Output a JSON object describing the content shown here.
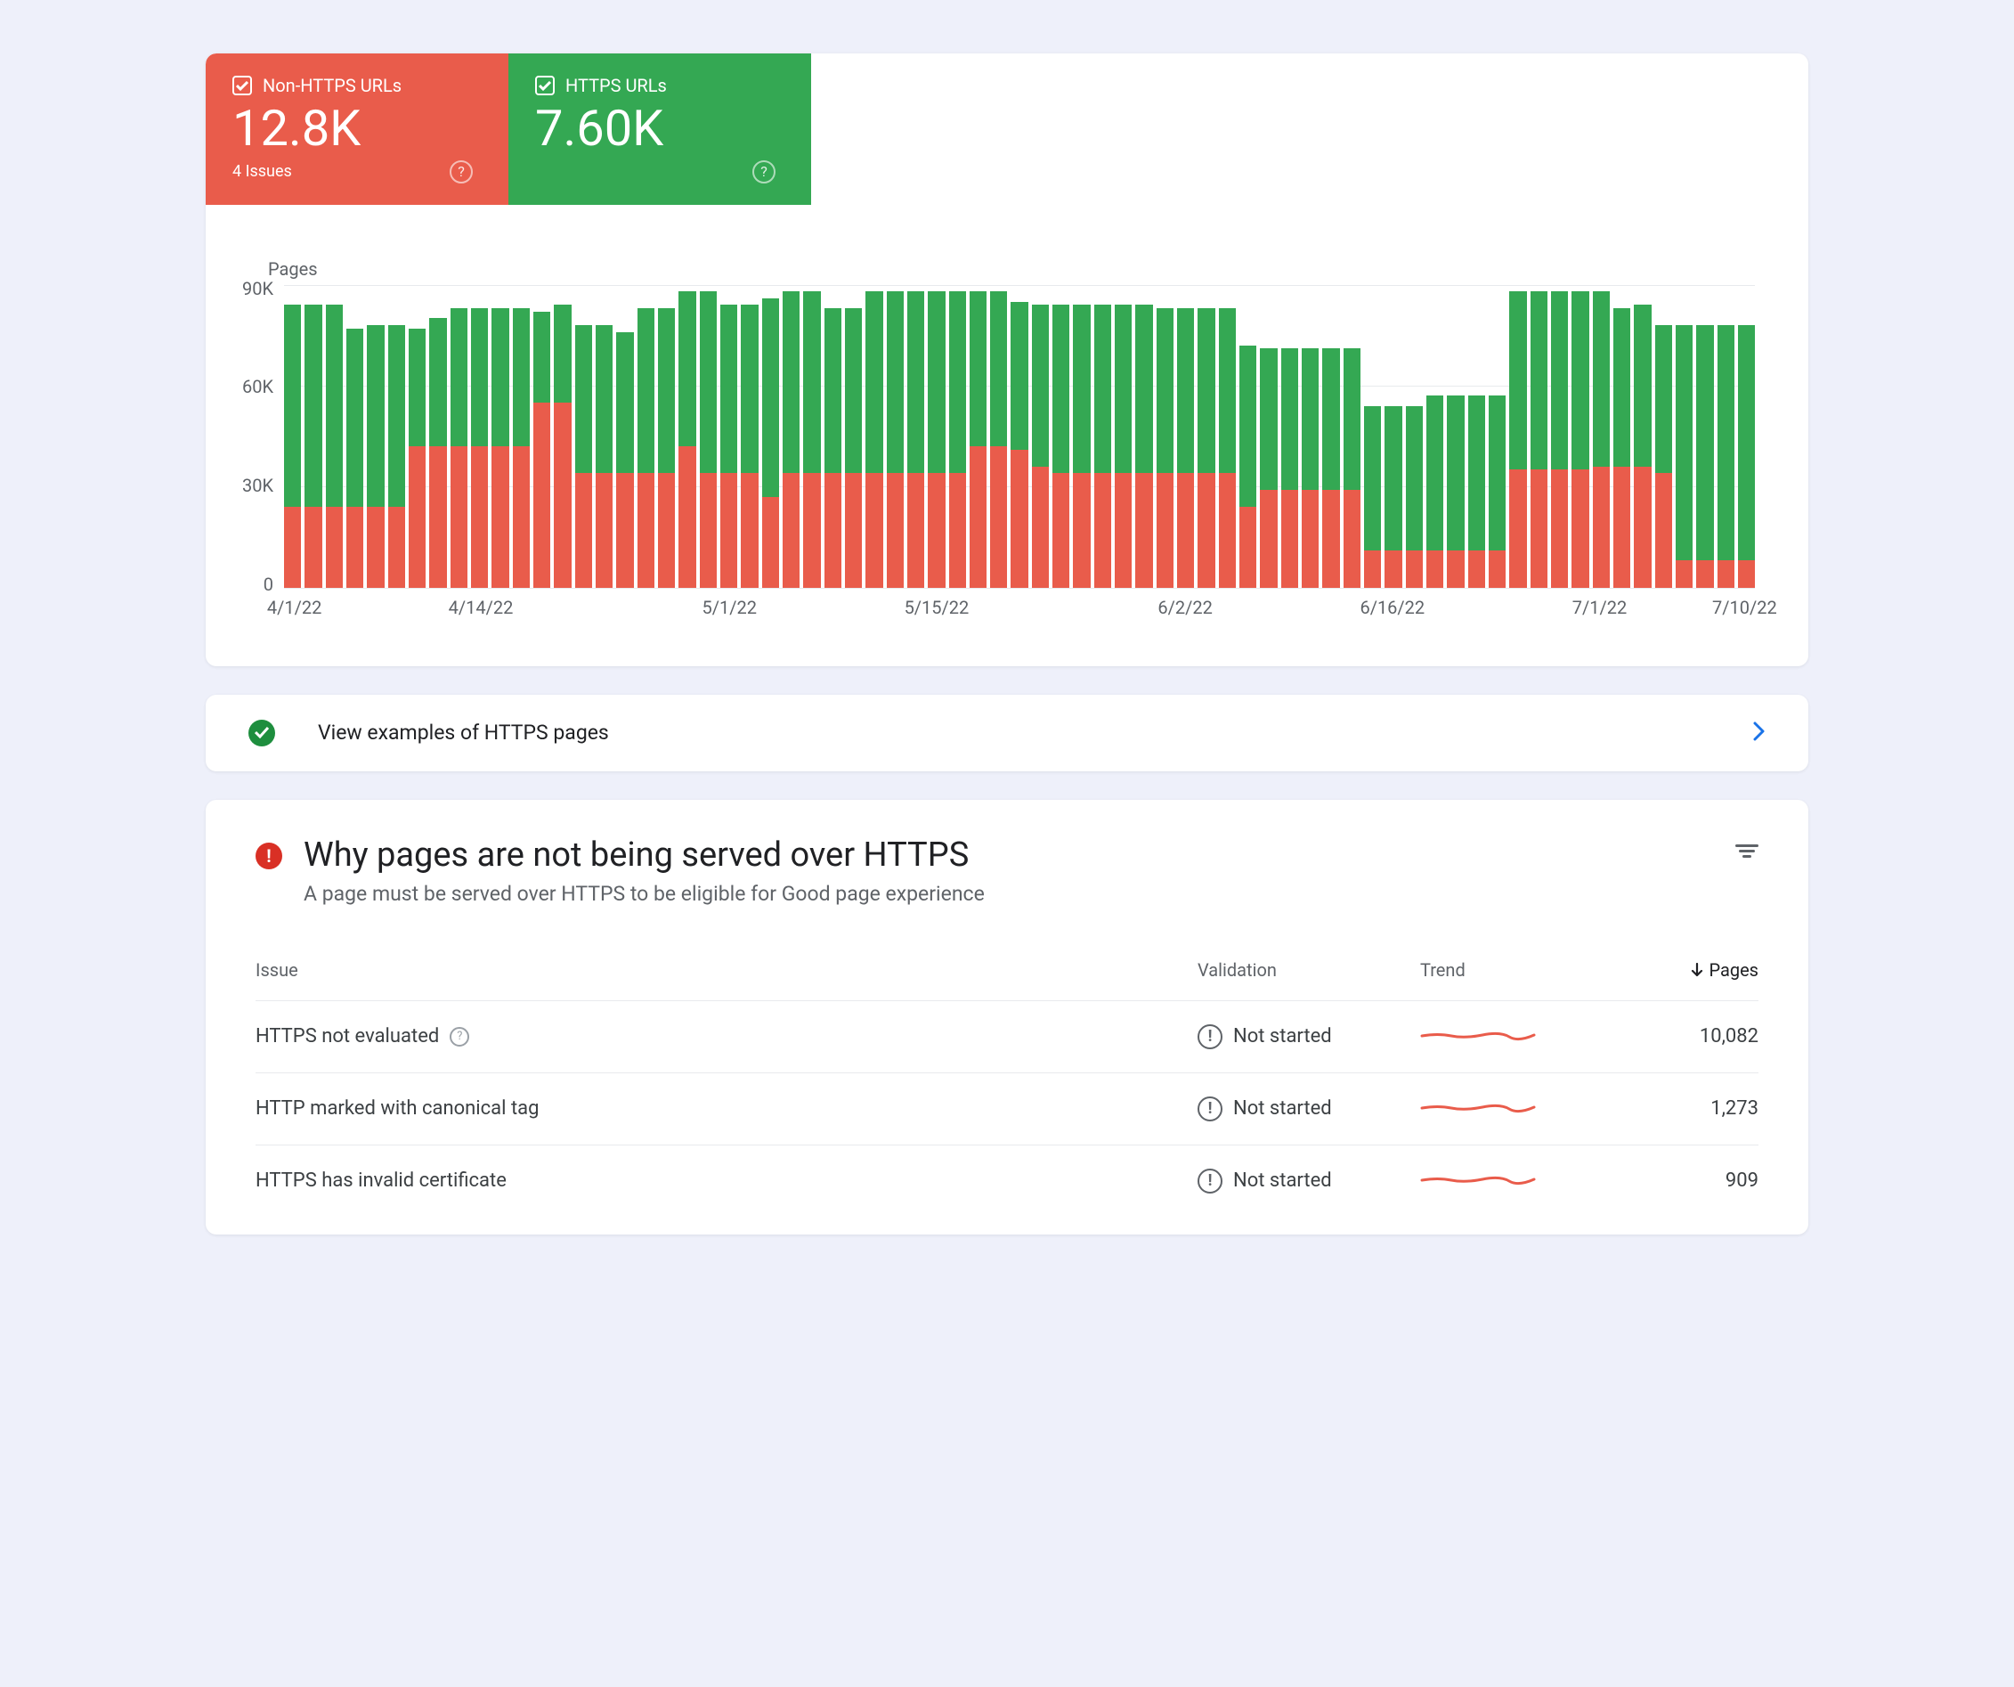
{
  "tabs": {
    "nonHttps": {
      "label": "Non-HTTPS URLs",
      "value": "12.8K",
      "issues": "4 Issues"
    },
    "https": {
      "label": "HTTPS URLs",
      "value": "7.60K"
    }
  },
  "colors": {
    "red": "#e95c4b",
    "green": "#34a853",
    "blue": "#1a73e8",
    "alert": "#d93025"
  },
  "chart_data": {
    "type": "bar",
    "ylabel": "Pages",
    "ylim": [
      0,
      90
    ],
    "y_unit": "K",
    "y_ticks": [
      0,
      30,
      60,
      90
    ],
    "x_ticks": [
      {
        "label": "4/1/22",
        "index": 0
      },
      {
        "label": "4/14/22",
        "index": 9
      },
      {
        "label": "5/1/22",
        "index": 21
      },
      {
        "label": "5/15/22",
        "index": 31
      },
      {
        "label": "6/2/22",
        "index": 43
      },
      {
        "label": "6/16/22",
        "index": 53
      },
      {
        "label": "7/1/22",
        "index": 63
      },
      {
        "label": "7/10/22",
        "index": 70
      }
    ],
    "series_stacked": [
      {
        "name": "Non-HTTPS URLs",
        "color": "#e95c4b"
      },
      {
        "name": "HTTPS URLs",
        "color": "#34a853"
      }
    ],
    "bars": [
      {
        "nonHttps": 24,
        "https": 60
      },
      {
        "nonHttps": 24,
        "https": 60
      },
      {
        "nonHttps": 24,
        "https": 60
      },
      {
        "nonHttps": 24,
        "https": 53
      },
      {
        "nonHttps": 24,
        "https": 54
      },
      {
        "nonHttps": 24,
        "https": 54
      },
      {
        "nonHttps": 42,
        "https": 35
      },
      {
        "nonHttps": 42,
        "https": 38
      },
      {
        "nonHttps": 42,
        "https": 41
      },
      {
        "nonHttps": 42,
        "https": 41
      },
      {
        "nonHttps": 42,
        "https": 41
      },
      {
        "nonHttps": 42,
        "https": 41
      },
      {
        "nonHttps": 55,
        "https": 27
      },
      {
        "nonHttps": 55,
        "https": 29
      },
      {
        "nonHttps": 34,
        "https": 44
      },
      {
        "nonHttps": 34,
        "https": 44
      },
      {
        "nonHttps": 34,
        "https": 42
      },
      {
        "nonHttps": 34,
        "https": 49
      },
      {
        "nonHttps": 34,
        "https": 49
      },
      {
        "nonHttps": 42,
        "https": 46
      },
      {
        "nonHttps": 34,
        "https": 54
      },
      {
        "nonHttps": 34,
        "https": 50
      },
      {
        "nonHttps": 34,
        "https": 50
      },
      {
        "nonHttps": 27,
        "https": 59
      },
      {
        "nonHttps": 34,
        "https": 54
      },
      {
        "nonHttps": 34,
        "https": 54
      },
      {
        "nonHttps": 34,
        "https": 49
      },
      {
        "nonHttps": 34,
        "https": 49
      },
      {
        "nonHttps": 34,
        "https": 54
      },
      {
        "nonHttps": 34,
        "https": 54
      },
      {
        "nonHttps": 34,
        "https": 54
      },
      {
        "nonHttps": 34,
        "https": 54
      },
      {
        "nonHttps": 34,
        "https": 54
      },
      {
        "nonHttps": 42,
        "https": 46
      },
      {
        "nonHttps": 42,
        "https": 46
      },
      {
        "nonHttps": 41,
        "https": 44
      },
      {
        "nonHttps": 36,
        "https": 48
      },
      {
        "nonHttps": 34,
        "https": 50
      },
      {
        "nonHttps": 34,
        "https": 50
      },
      {
        "nonHttps": 34,
        "https": 50
      },
      {
        "nonHttps": 34,
        "https": 50
      },
      {
        "nonHttps": 34,
        "https": 50
      },
      {
        "nonHttps": 34,
        "https": 49
      },
      {
        "nonHttps": 34,
        "https": 49
      },
      {
        "nonHttps": 34,
        "https": 49
      },
      {
        "nonHttps": 34,
        "https": 49
      },
      {
        "nonHttps": 24,
        "https": 48
      },
      {
        "nonHttps": 29,
        "https": 42
      },
      {
        "nonHttps": 29,
        "https": 42
      },
      {
        "nonHttps": 29,
        "https": 42
      },
      {
        "nonHttps": 29,
        "https": 42
      },
      {
        "nonHttps": 29,
        "https": 42
      },
      {
        "nonHttps": 11,
        "https": 43
      },
      {
        "nonHttps": 11,
        "https": 43
      },
      {
        "nonHttps": 11,
        "https": 43
      },
      {
        "nonHttps": 11,
        "https": 46
      },
      {
        "nonHttps": 11,
        "https": 46
      },
      {
        "nonHttps": 11,
        "https": 46
      },
      {
        "nonHttps": 11,
        "https": 46
      },
      {
        "nonHttps": 35,
        "https": 53
      },
      {
        "nonHttps": 35,
        "https": 53
      },
      {
        "nonHttps": 35,
        "https": 53
      },
      {
        "nonHttps": 35,
        "https": 53
      },
      {
        "nonHttps": 36,
        "https": 52
      },
      {
        "nonHttps": 36,
        "https": 47
      },
      {
        "nonHttps": 36,
        "https": 48
      },
      {
        "nonHttps": 34,
        "https": 44
      },
      {
        "nonHttps": 8,
        "https": 70
      },
      {
        "nonHttps": 8,
        "https": 70
      },
      {
        "nonHttps": 8,
        "https": 70
      },
      {
        "nonHttps": 8,
        "https": 70
      }
    ]
  },
  "link_row": {
    "label": "View examples of HTTPS pages"
  },
  "issues_section": {
    "title": "Why pages are not being served over HTTPS",
    "subtitle": "A page must be served over HTTPS to be eligible for Good page experience",
    "columns": {
      "issue": "Issue",
      "validation": "Validation",
      "trend": "Trend",
      "pages": "Pages"
    },
    "rows": [
      {
        "name": "HTTPS not evaluated",
        "help": true,
        "validation": "Not started",
        "pages": "10,082"
      },
      {
        "name": "HTTP marked with canonical tag",
        "help": false,
        "validation": "Not started",
        "pages": "1,273"
      },
      {
        "name": "HTTPS has invalid certificate",
        "help": false,
        "validation": "Not started",
        "pages": "909"
      }
    ]
  }
}
